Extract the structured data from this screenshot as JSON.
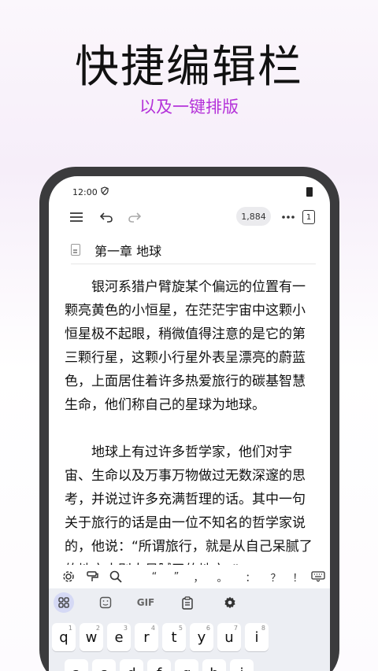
{
  "hero": {
    "title": "快捷编辑栏",
    "subtitle": "以及一键排版"
  },
  "status": {
    "time": "12:00"
  },
  "toolbar": {
    "word_count": "1,884",
    "page_label": "1"
  },
  "chapter": {
    "title": "第一章 地球"
  },
  "content": {
    "paragraphs": [
      "银河系猎户臂旋某个偏远的位置有一颗亮黄色的小恒星，在茫茫宇宙中这颗小恒星极不起眼，稍微值得注意的是它的第三颗行星，这颗小行星外表呈漂亮的蔚蓝色，上面居住着许多热爱旅行的碳基智慧生命，他们称自己的星球为地球。",
      "地球上有过许多哲学家，他们对宇宙、生命以及万事万物做过无数深邃的思考，并说过许多充满哲理的话。其中一句关于旅行的话是由一位不知名的哲学家说的，他说：“所谓旅行，就是从自己呆腻了的地方去别人呆腻了的地方。”"
    ]
  },
  "format_bar": {
    "quote_open": "“",
    "quote_close": "”",
    "comma": "，",
    "period": "。",
    "colon": "：",
    "question": "？",
    "exclaim": "！"
  },
  "keyboard": {
    "gif_label": "GIF",
    "row1": [
      {
        "k": "q",
        "h": "1"
      },
      {
        "k": "w",
        "h": "2"
      },
      {
        "k": "e",
        "h": "3"
      },
      {
        "k": "r",
        "h": "4"
      },
      {
        "k": "t",
        "h": "5"
      },
      {
        "k": "y",
        "h": "6"
      },
      {
        "k": "u",
        "h": "7"
      },
      {
        "k": "i",
        "h": "8"
      }
    ],
    "row2": [
      "a",
      "s",
      "d",
      "f",
      "g",
      "h",
      "j"
    ]
  }
}
